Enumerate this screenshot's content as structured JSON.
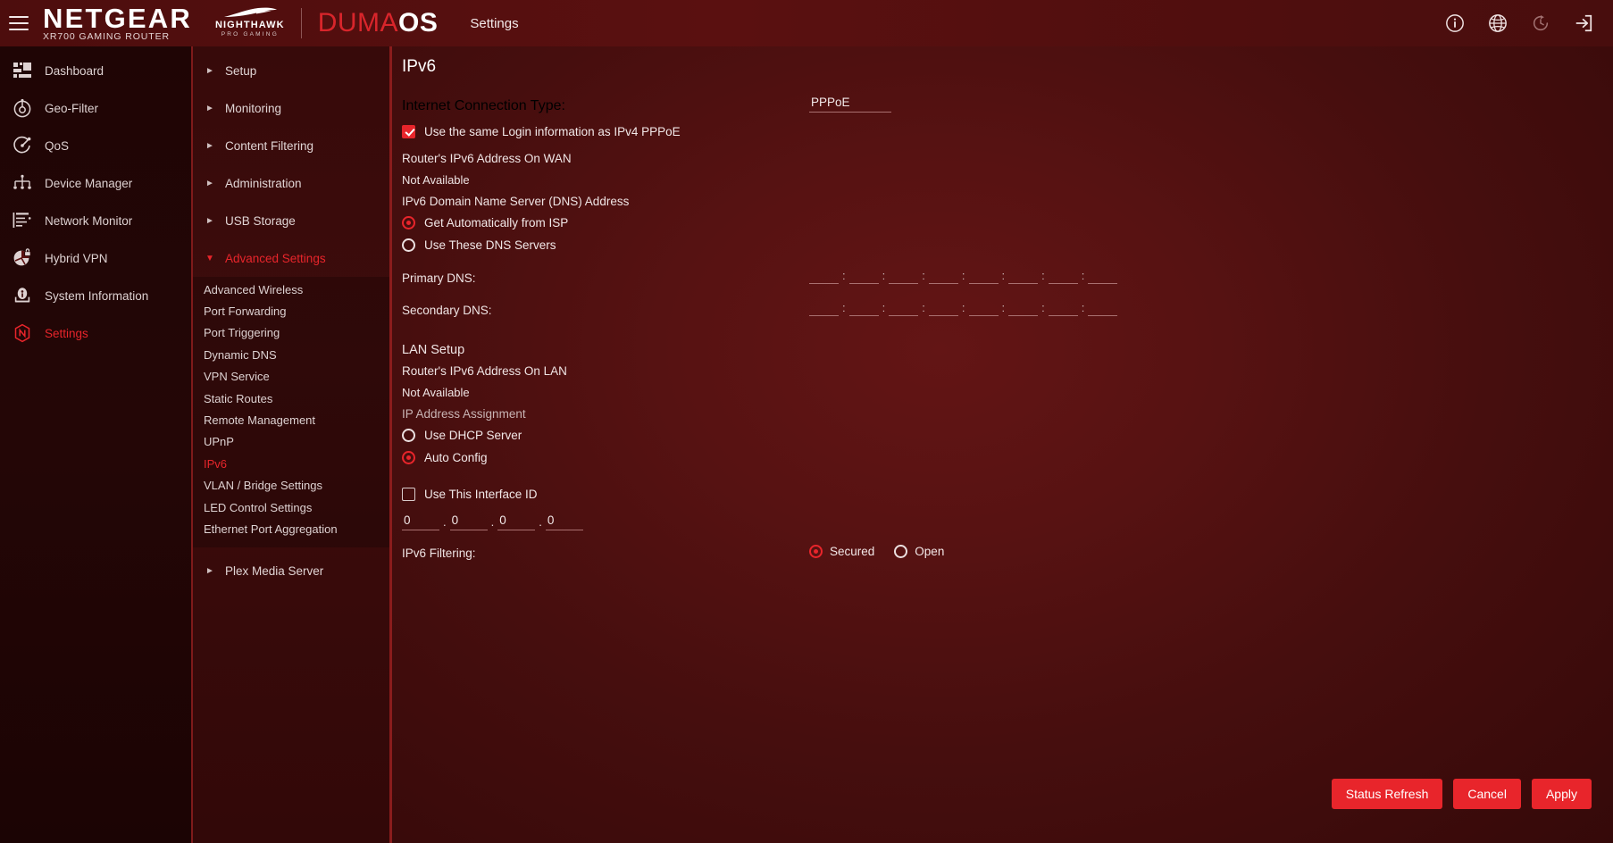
{
  "header": {
    "menu_icon": "hamburger-icon",
    "brand": "NETGEAR",
    "brand_sub": "XR700 GAMING ROUTER",
    "nighthawk": "NIGHTHAWK",
    "nighthawk_sub": "PRO GAMING",
    "duma_part1": "DUMA",
    "duma_part2": "OS",
    "page_label": "Settings",
    "icons": [
      "info-icon",
      "globe-icon",
      "history-refresh-icon",
      "logout-icon"
    ],
    "accent": "#e8252b"
  },
  "sidebar": {
    "items": [
      {
        "label": "Dashboard",
        "icon": "dashboard-icon",
        "active": false
      },
      {
        "label": "Geo-Filter",
        "icon": "geo-filter-icon",
        "active": false
      },
      {
        "label": "QoS",
        "icon": "qos-icon",
        "active": false
      },
      {
        "label": "Device Manager",
        "icon": "device-manager-icon",
        "active": false
      },
      {
        "label": "Network Monitor",
        "icon": "network-monitor-icon",
        "active": false
      },
      {
        "label": "Hybrid VPN",
        "icon": "hybrid-vpn-icon",
        "active": false
      },
      {
        "label": "System Information",
        "icon": "system-information-icon",
        "active": false
      },
      {
        "label": "Settings",
        "icon": "settings-netgear-icon",
        "active": true
      }
    ]
  },
  "subnav": {
    "groups": [
      {
        "label": "Setup",
        "expanded": false
      },
      {
        "label": "Monitoring",
        "expanded": false
      },
      {
        "label": "Content Filtering",
        "expanded": false
      },
      {
        "label": "Administration",
        "expanded": false
      },
      {
        "label": "USB Storage",
        "expanded": false
      },
      {
        "label": "Advanced Settings",
        "expanded": true
      }
    ],
    "advanced_children": [
      {
        "label": "Advanced Wireless",
        "active": false
      },
      {
        "label": "Port Forwarding",
        "active": false
      },
      {
        "label": "Port Triggering",
        "active": false
      },
      {
        "label": "Dynamic DNS",
        "active": false
      },
      {
        "label": "VPN Service",
        "active": false
      },
      {
        "label": "Static Routes",
        "active": false
      },
      {
        "label": "Remote Management",
        "active": false
      },
      {
        "label": "UPnP",
        "active": false
      },
      {
        "label": "IPv6",
        "active": true
      },
      {
        "label": "VLAN / Bridge Settings",
        "active": false
      },
      {
        "label": "LED Control Settings",
        "active": false
      },
      {
        "label": "Ethernet Port Aggregation",
        "active": false
      }
    ],
    "trailing_group": {
      "label": "Plex Media Server",
      "expanded": false
    },
    "arrow_collapsed": "►",
    "arrow_expanded": "▼"
  },
  "main": {
    "title": "IPv6",
    "connection_type_label": "Internet Connection Type:",
    "connection_type_value": "PPPoE",
    "same_login_label": "Use the same Login information as IPv4 PPPoE",
    "same_login_checked": true,
    "wan_address_label": "Router's IPv6 Address On WAN",
    "wan_address_value": "Not Available",
    "dns_section_label": "IPv6 Domain Name Server (DNS) Address",
    "dns_option_auto": "Get Automatically from ISP",
    "dns_option_manual": "Use These DNS Servers",
    "dns_selected": "auto",
    "primary_dns_label": "Primary DNS:",
    "primary_dns_segments": [
      "",
      "",
      "",
      "",
      "",
      "",
      "",
      ""
    ],
    "secondary_dns_label": "Secondary DNS:",
    "secondary_dns_segments": [
      "",
      "",
      "",
      "",
      "",
      "",
      "",
      ""
    ],
    "dns_separator": ":",
    "lan_setup_label": "LAN Setup",
    "lan_address_label": "Router's IPv6 Address On LAN",
    "lan_address_value": "Not Available",
    "ip_assignment_label": "IP Address Assignment",
    "assign_option_dhcp": "Use DHCP Server",
    "assign_option_auto": "Auto Config",
    "assign_selected": "auto",
    "interface_id_label": "Use This Interface ID",
    "interface_id_checked": false,
    "interface_id_segments": [
      "0",
      "0",
      "0",
      "0"
    ],
    "interface_id_separator": ".",
    "filtering_label": "IPv6 Filtering:",
    "filter_option_secured": "Secured",
    "filter_option_open": "Open",
    "filter_selected": "secured"
  },
  "buttons": {
    "status_refresh": "Status Refresh",
    "cancel": "Cancel",
    "apply": "Apply"
  }
}
